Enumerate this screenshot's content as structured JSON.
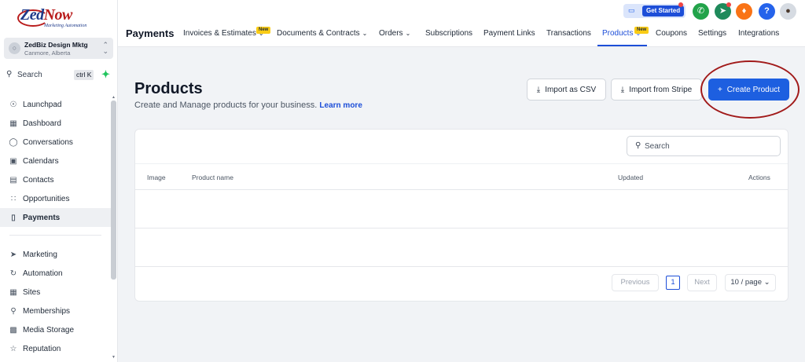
{
  "sidebar": {
    "logo": {
      "brand_a": "Zed",
      "brand_b": "Now",
      "tagline": "Marketing Automation"
    },
    "account": {
      "name": "ZedBiz Design Mktg",
      "location": "Canmore, Alberta"
    },
    "search": {
      "label": "Search",
      "shortcut": "ctrl K"
    },
    "items_top": [
      {
        "label": "Launchpad",
        "icon": "rocket-icon"
      },
      {
        "label": "Dashboard",
        "icon": "grid-icon"
      },
      {
        "label": "Conversations",
        "icon": "chat-icon"
      },
      {
        "label": "Calendars",
        "icon": "calendar-icon"
      },
      {
        "label": "Contacts",
        "icon": "contacts-icon"
      },
      {
        "label": "Opportunities",
        "icon": "opportunities-icon"
      },
      {
        "label": "Payments",
        "icon": "payments-icon",
        "active": true
      }
    ],
    "items_bottom": [
      {
        "label": "Marketing",
        "icon": "send-icon"
      },
      {
        "label": "Automation",
        "icon": "automation-icon"
      },
      {
        "label": "Sites",
        "icon": "sites-icon"
      },
      {
        "label": "Memberships",
        "icon": "badge-icon"
      },
      {
        "label": "Media Storage",
        "icon": "image-icon"
      },
      {
        "label": "Reputation",
        "icon": "star-icon"
      }
    ]
  },
  "header": {
    "get_started": "Get Started",
    "section_title": "Payments",
    "tabs": [
      {
        "label": "Invoices & Estimates",
        "new": "New",
        "dropdown": true
      },
      {
        "label": "Documents & Contracts",
        "dropdown": true
      },
      {
        "label": "Orders",
        "dropdown": true
      },
      {
        "label": "Subscriptions"
      },
      {
        "label": "Payment Links"
      },
      {
        "label": "Transactions"
      },
      {
        "label": "Products",
        "new": "New",
        "dropdown": true,
        "active": true
      },
      {
        "label": "Coupons"
      },
      {
        "label": "Settings"
      },
      {
        "label": "Integrations"
      }
    ]
  },
  "main": {
    "title": "Products",
    "subtitle": "Create and Manage products for your business.",
    "learn_more": "Learn more",
    "import_csv": "Import as CSV",
    "import_stripe": "Import from Stripe",
    "create_product": "Create Product",
    "search_placeholder": "Search",
    "columns": {
      "image": "Image",
      "product_name": "Product name",
      "updated": "Updated",
      "actions": "Actions"
    },
    "pagination": {
      "previous": "Previous",
      "page": "1",
      "next": "Next",
      "page_size": "10 / page"
    }
  },
  "colors": {
    "accent": "#1d5fe0",
    "annotation": "#a11a1a",
    "badge": "#facc15"
  }
}
